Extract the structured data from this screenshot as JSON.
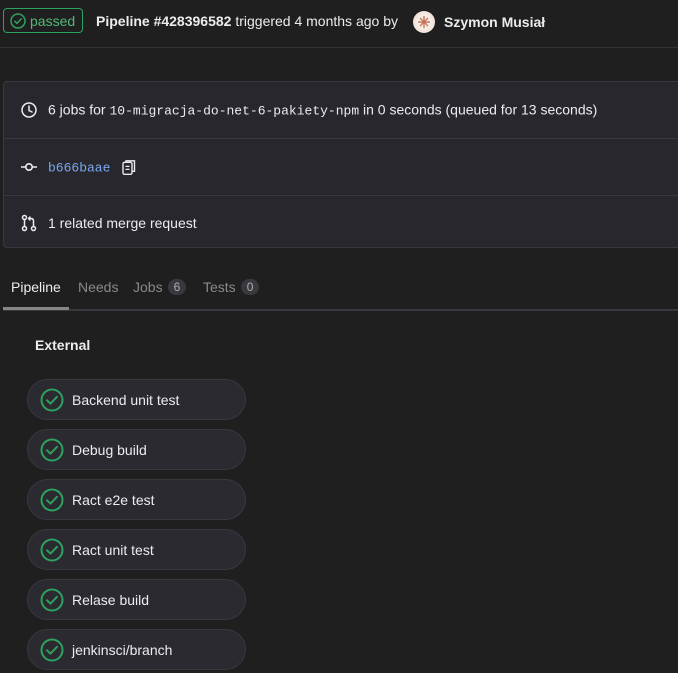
{
  "header": {
    "status": "passed",
    "pipeline_label": "Pipeline #428396582",
    "triggered_text": "triggered 4 months ago by",
    "author": "Szymon Musiał"
  },
  "info": {
    "jobs_prefix": "6 jobs for",
    "branch": "10-migracja-do-net-6-pakiety-npm",
    "jobs_suffix": "in 0 seconds (queued for 13 seconds)",
    "commit_sha": "b666baae",
    "merge_request": "1 related merge request"
  },
  "tabs": [
    {
      "label": "Pipeline"
    },
    {
      "label": "Needs"
    },
    {
      "label": "Jobs",
      "count": "6"
    },
    {
      "label": "Tests",
      "count": "0"
    }
  ],
  "stage": {
    "title": "External",
    "jobs": [
      {
        "label": "Backend unit test"
      },
      {
        "label": "Debug build"
      },
      {
        "label": "Ract e2e test"
      },
      {
        "label": "Ract unit test"
      },
      {
        "label": "Relase build"
      },
      {
        "label": "jenkinsci/branch"
      }
    ]
  },
  "colors": {
    "success": "#2da160",
    "link": "#7aa7ef",
    "background": "#1f1f1f"
  },
  "icons": {
    "status": "check-circle-icon",
    "clock": "clock-icon",
    "commit": "commit-icon",
    "copy": "copy-icon",
    "merge_request": "merge-request-icon"
  }
}
